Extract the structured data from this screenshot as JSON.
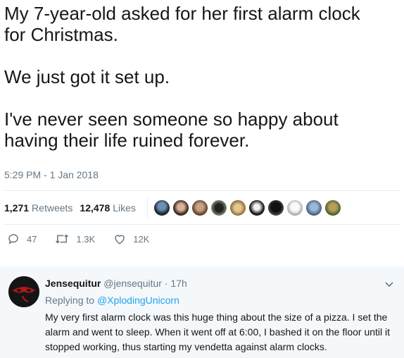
{
  "tweet": {
    "lines_block1": [
      "My 7-year-old asked for her first alarm clock",
      "for Christmas."
    ],
    "line_block2": "We just got it set up.",
    "lines_block3": [
      "I've never seen someone so happy about",
      "having their life ruined forever."
    ],
    "timestamp": "5:29 PM - 1 Jan 2018"
  },
  "stats": {
    "retweets_count": "1,271",
    "retweets_label": "Retweets",
    "likes_count": "12,478",
    "likes_label": "Likes"
  },
  "actions": {
    "replies": "47",
    "retweets": "1.3K",
    "likes": "12K"
  },
  "reply": {
    "name": "Jensequitur",
    "handle": "@jensequitur",
    "separator": "·",
    "time": "17h",
    "replying_prefix": "Replying to",
    "replying_to": "@XplodingUnicorn",
    "body_lines": [
      "My very first alarm clock was this huge thing about the size of a pizza. I set the",
      "alarm and went to sleep. When it went off at 6:00, I bashed it on the floor until it",
      "stopped working, thus starting my vendetta against alarm clocks."
    ]
  },
  "colors": {
    "accent": "#1da1f2",
    "muted": "#657786",
    "reply_bg": "#f5f8fa"
  }
}
